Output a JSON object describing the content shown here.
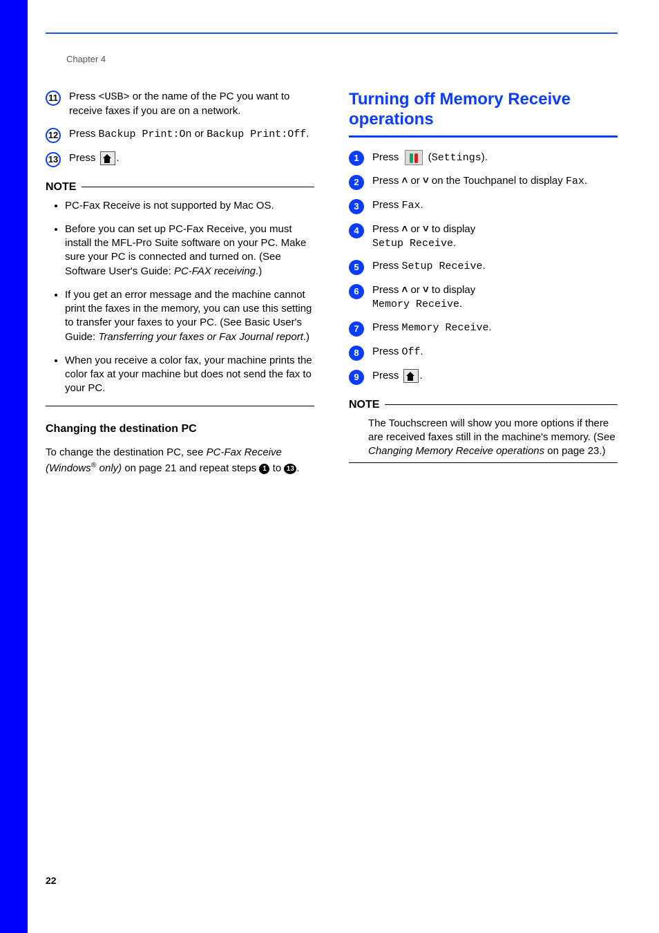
{
  "chapter": "Chapter 4",
  "left": {
    "step11_a": "Press ",
    "step11_mono": "<USB>",
    "step11_b": " or the name of the PC you want to receive faxes if you are on a network.",
    "step12_a": "Press ",
    "step12_mono1": "Backup Print:On",
    "step12_b": " or ",
    "step12_mono2": "Backup Print:Off",
    "step12_c": ".",
    "step13_a": "Press ",
    "step13_b": ".",
    "note_label": "NOTE",
    "note_items": [
      "PC-Fax Receive is not supported by Mac OS.",
      "Before you can set up PC-Fax Receive, you must install the MFL-Pro Suite software on your PC. Make sure your PC is connected and turned on. (See Software User's Guide: ",
      "If you get an error message and the machine cannot print the faxes in the memory, you can use this setting to transfer your faxes to your PC. (See Basic User's Guide: ",
      "When you receive a color fax, your machine prints the color fax at your machine but does not send the fax to your PC."
    ],
    "note_item2_ital": "PC-FAX receiving",
    "note_item2_end": ".)",
    "note_item3_ital": "Transferring your faxes or Fax Journal report",
    "note_item3_end": ".)",
    "subhead": "Changing the destination PC",
    "para_a": "To change the destination PC, see ",
    "para_ital": "PC-Fax Receive (Windows",
    "para_sup": "®",
    "para_ital2": " only)",
    "para_b": " on page 21 and repeat steps ",
    "para_to": " to ",
    "para_c": "."
  },
  "right": {
    "heading": "Turning off Memory Receive operations",
    "step1_a": "Press ",
    "step1_b": " (",
    "step1_mono": "Settings",
    "step1_c": ").",
    "step2_a": "Press ",
    "step2_b": " or ",
    "step2_c": " on the Touchpanel to display ",
    "step2_mono": "Fax",
    "step2_d": ".",
    "step3_a": "Press ",
    "step3_mono": "Fax",
    "step3_b": ".",
    "step4_a": "Press ",
    "step4_b": " or ",
    "step4_c": " to display ",
    "step4_mono": "Setup Receive",
    "step4_d": ".",
    "step5_a": "Press ",
    "step5_mono": "Setup Receive",
    "step5_b": ".",
    "step6_a": "Press ",
    "step6_b": " or ",
    "step6_c": " to display ",
    "step6_mono": "Memory Receive",
    "step6_d": ".",
    "step7_a": "Press ",
    "step7_mono": "Memory Receive",
    "step7_b": ".",
    "step8_a": "Press ",
    "step8_mono": "Off",
    "step8_b": ".",
    "step9_a": "Press ",
    "step9_b": ".",
    "note_label": "NOTE",
    "note_body_a": "The Touchscreen will show you more options if there are received faxes still in the machine's memory. (See ",
    "note_body_ital": "Changing Memory Receive operations",
    "note_body_b": " on page 23.)"
  },
  "page_number": "22",
  "step_numbers": {
    "l11": "11",
    "l12": "12",
    "l13": "13",
    "r1": "1",
    "r2": "2",
    "r3": "3",
    "r4": "4",
    "r5": "5",
    "r6": "6",
    "r7": "7",
    "r8": "8",
    "r9": "9",
    "small1": "1",
    "small13": "13"
  },
  "carets": {
    "up": "˄",
    "down": "˅"
  }
}
